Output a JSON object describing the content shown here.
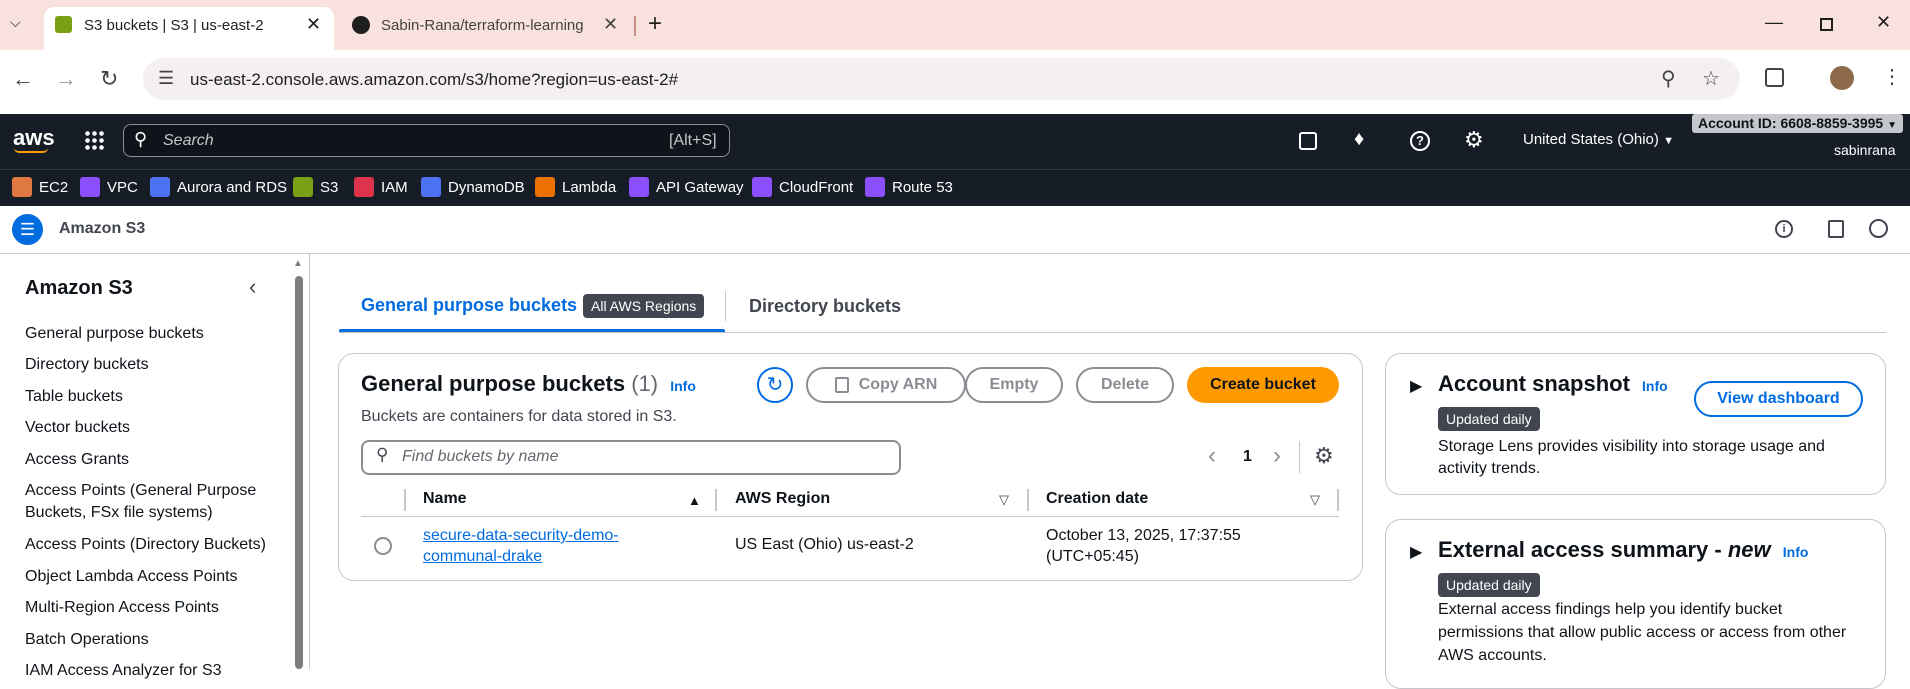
{
  "browser": {
    "tabs": [
      {
        "title": "S3 buckets | S3 | us-east-2"
      },
      {
        "title": "Sabin-Rana/terraform-learning"
      }
    ],
    "url": "us-east-2.console.aws.amazon.com/s3/home?region=us-east-2#"
  },
  "aws_header": {
    "logo": "aws",
    "search_placeholder": "Search",
    "search_shortcut": "[Alt+S]",
    "region": "United States (Ohio)",
    "account_id": "Account ID: 6608-8859-3995",
    "username": "sabinrana"
  },
  "favorites": [
    {
      "label": "EC2",
      "color": "#e07941"
    },
    {
      "label": "VPC",
      "color": "#8c4fff"
    },
    {
      "label": "Aurora and RDS",
      "color": "#4d72f3"
    },
    {
      "label": "S3",
      "color": "#7aa116"
    },
    {
      "label": "IAM",
      "color": "#dd344c"
    },
    {
      "label": "DynamoDB",
      "color": "#4d72f3"
    },
    {
      "label": "Lambda",
      "color": "#ed7100"
    },
    {
      "label": "API Gateway",
      "color": "#8c4fff"
    },
    {
      "label": "CloudFront",
      "color": "#8c4fff"
    },
    {
      "label": "Route 53",
      "color": "#8c4fff"
    }
  ],
  "subbar": {
    "service_name": "Amazon S3"
  },
  "sidebar": {
    "title": "Amazon S3",
    "items": [
      {
        "label": "General purpose buckets"
      },
      {
        "label": "Directory buckets"
      },
      {
        "label": "Table buckets"
      },
      {
        "label": "Vector buckets"
      },
      {
        "label": "Access Grants"
      },
      {
        "label": "Access Points (General Purpose Buckets, FSx file systems)"
      },
      {
        "label": "Access Points (Directory Buckets)"
      },
      {
        "label": "Object Lambda Access Points"
      },
      {
        "label": "Multi-Region Access Points"
      },
      {
        "label": "Batch Operations"
      },
      {
        "label": "IAM Access Analyzer for S3"
      }
    ]
  },
  "tabs": {
    "general": "General purpose buckets",
    "general_badge": "All AWS Regions",
    "directory": "Directory buckets"
  },
  "buckets_panel": {
    "title": "General purpose buckets",
    "count": "(1)",
    "info": "Info",
    "description": "Buckets are containers for data stored in S3.",
    "copy_arn": "Copy ARN",
    "empty": "Empty",
    "delete": "Delete",
    "create": "Create bucket",
    "find_placeholder": "Find buckets by name",
    "page": "1",
    "columns": {
      "name": "Name",
      "region": "AWS Region",
      "created": "Creation date"
    },
    "rows": [
      {
        "name_line1": "secure-data-security-demo-",
        "name_line2": "communal-drake",
        "region": "US East (Ohio) us-east-2",
        "created_line1": "October 13, 2025, 17:37:55",
        "created_line2": "(UTC+05:45)"
      }
    ]
  },
  "snapshot": {
    "title": "Account snapshot",
    "info": "Info",
    "button": "View dashboard",
    "badge": "Updated daily",
    "desc_line1": "Storage Lens provides visibility into storage usage and",
    "desc_line2": "activity trends."
  },
  "external": {
    "title_prefix": "External access summary - ",
    "title_new": "new",
    "info": "Info",
    "badge": "Updated daily",
    "desc_line1": "External access findings help you identify bucket",
    "desc_line2": "permissions that allow public access or access from other",
    "desc_line3": "AWS accounts."
  },
  "colors": {
    "accent": "#006ce0",
    "primary_button": "#ff9900",
    "header_bg": "#161d26"
  }
}
